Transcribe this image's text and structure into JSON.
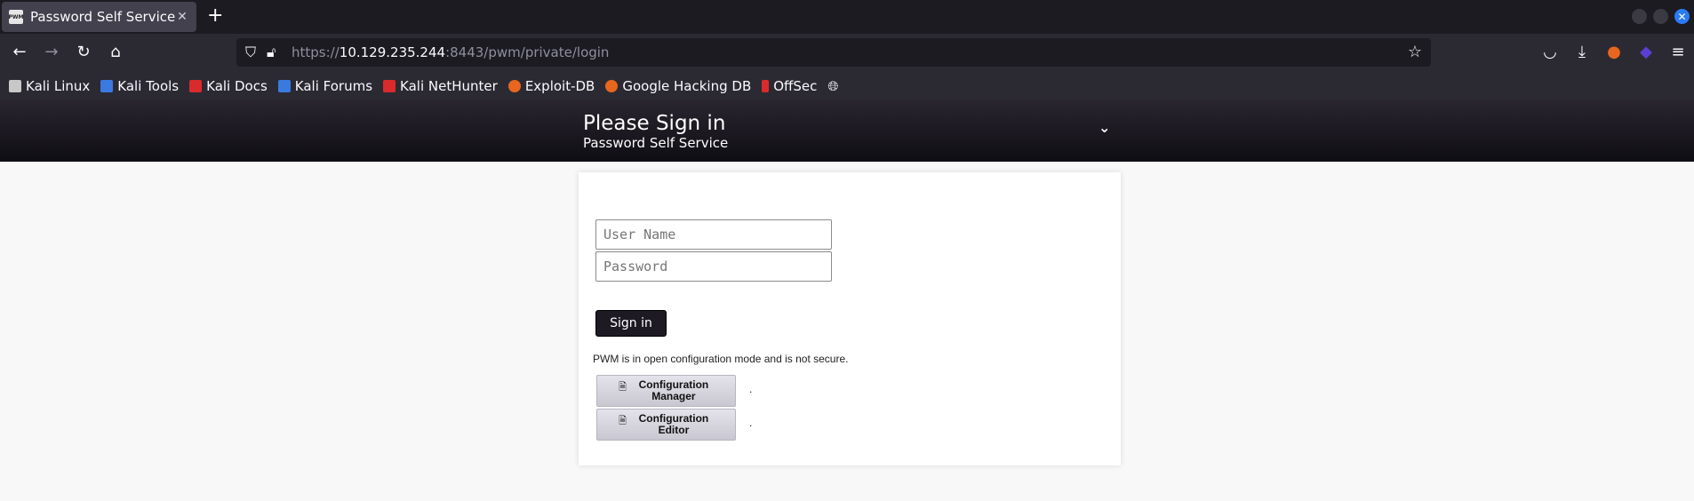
{
  "browser": {
    "tab": {
      "favicon_text": "PWM",
      "title": "Password Self Service"
    },
    "url": {
      "scheme": "https://",
      "host": "10.129.235.244",
      "rest": ":8443/pwm/private/login"
    },
    "bookmarks": [
      {
        "label": "Kali Linux",
        "color": "#ffffff"
      },
      {
        "label": "Kali Tools",
        "color": "#3a7ae0"
      },
      {
        "label": "Kali Docs",
        "color": "#d92b2b"
      },
      {
        "label": "Kali Forums",
        "color": "#3a7ae0"
      },
      {
        "label": "Kali NetHunter",
        "color": "#d92b2b"
      },
      {
        "label": "Exploit-DB",
        "color": "#e8661e"
      },
      {
        "label": "Google Hacking DB",
        "color": "#e8661e"
      },
      {
        "label": "OffSec",
        "color": "#d92b2b"
      }
    ]
  },
  "header": {
    "title": "Please Sign in",
    "subtitle": "Password Self Service"
  },
  "login": {
    "username_placeholder": "User Name",
    "password_placeholder": "Password",
    "signin_label": "Sign in",
    "notice": "PWM is in open configuration mode and is not secure.",
    "config_manager_label": "Configuration Manager",
    "config_editor_label": "Configuration Editor",
    "dot": "."
  },
  "colors": {
    "header_bg": "#1a1720",
    "signin_bg": "#1d1a24",
    "page_bg": "#f8f8f8"
  }
}
